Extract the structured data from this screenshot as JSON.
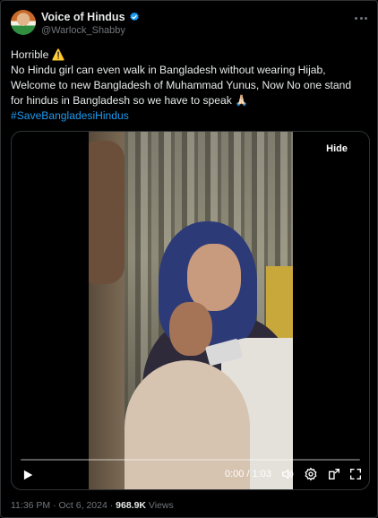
{
  "post": {
    "author": {
      "display_name": "Voice of Hindus",
      "handle": "@Warlock_Shabby"
    },
    "text_lines": [
      "Horrible ⚠️",
      "No Hindu girl can even walk in Bangladesh without wearing Hijab,",
      "Welcome to new Bangladesh of Muhammad Yunus, Now No one stand",
      "for hindus in Bangladesh so we have to speak 🙏🏻"
    ],
    "hashtag": "#SaveBangladesiHindus",
    "media": {
      "hide_label": "Hide",
      "time_display": "0:00 / 1:03",
      "progress_fraction": 0.0
    },
    "meta": {
      "time": "11:36 PM",
      "separator": " · ",
      "date": "Oct 6, 2024",
      "views_count": "968.9K",
      "views_label": " Views"
    }
  },
  "colors": {
    "background": "#000000",
    "text": "#e7e9ea",
    "muted": "#71767b",
    "accent": "#1d9bf0",
    "border": "#2f3336"
  },
  "icons": [
    "verified-badge-icon",
    "more-options-icon",
    "play-icon",
    "volume-icon",
    "settings-icon",
    "fullscreen-exit-icon",
    "fullscreen-icon"
  ]
}
